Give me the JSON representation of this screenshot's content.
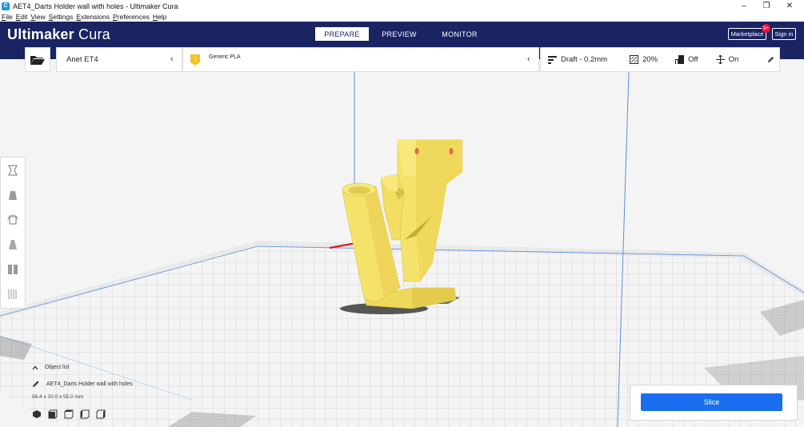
{
  "window": {
    "title": "AET4_Darts Holder wall with holes - Ultimaker Cura",
    "app_icon_letter": "C",
    "minimize_glyph": "–",
    "maximize_glyph": "❐",
    "close_glyph": "✕"
  },
  "menu": [
    {
      "accel": "F",
      "rest": "ile"
    },
    {
      "accel": "E",
      "rest": "dit"
    },
    {
      "accel": "V",
      "rest": "iew"
    },
    {
      "accel": "S",
      "rest": "ettings"
    },
    {
      "accel": "E",
      "rest": "xtensions"
    },
    {
      "accel": "P",
      "rest": "references"
    },
    {
      "accel": "H",
      "rest": "elp"
    }
  ],
  "header": {
    "brand_bold": "Ultimaker",
    "brand_light": " Cura",
    "stages": [
      "PREPARE",
      "PREVIEW",
      "MONITOR"
    ],
    "active_stage": "PREPARE",
    "marketplace_label": "Marketplace",
    "marketplace_badge": "9+",
    "signin_label": "Sign in"
  },
  "toolbar": {
    "printer": "Anet ET4",
    "extruder_number": "1",
    "material": "Generic PLA",
    "profile": "Draft - 0.2mm",
    "infill": "20%",
    "support": "Off",
    "adhesion": "On"
  },
  "object": {
    "list_label": "Object list",
    "name": "AET4_Darts Holder wall with holes",
    "dimensions": "56.4 x 20.0 x 55.0 mm"
  },
  "slice_label": "Slice",
  "colors": {
    "header": "#1a2463",
    "accent": "#196ef0",
    "model": "#f5e36b",
    "badge": "#e3143c"
  }
}
